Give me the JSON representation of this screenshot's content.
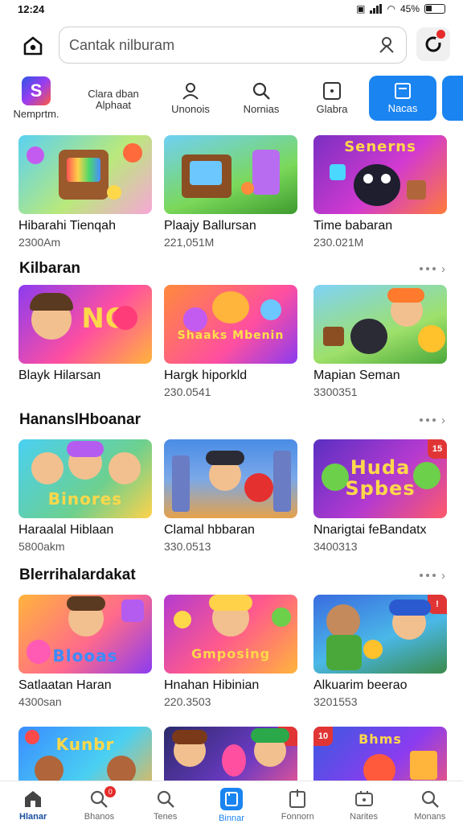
{
  "status": {
    "time": "12:24",
    "battery": "45%"
  },
  "search": {
    "placeholder": "Cantak nilburam"
  },
  "categories": [
    {
      "label": "Nemprtm.",
      "icon": "app-logo-icon"
    },
    {
      "label": "Clara dban Alphaat",
      "icon": "text-icon"
    },
    {
      "label": "Unonois",
      "icon": "person-icon"
    },
    {
      "label": "Nornias",
      "icon": "search-icon"
    },
    {
      "label": "Glabra",
      "icon": "square-icon"
    },
    {
      "label": "Nacas",
      "icon": "tablet-icon"
    }
  ],
  "sections": [
    {
      "title": "",
      "cards": [
        {
          "title": "Hibarahi Tienqah",
          "sub": "2300Am"
        },
        {
          "title": "Plaajy Ballursan",
          "sub": "221,051M"
        },
        {
          "title": "Time babaran",
          "sub": "230.021M",
          "banner": "Senerns"
        }
      ]
    },
    {
      "title": "Kilbaran",
      "cards": [
        {
          "title": "Blayk Hilarsan",
          "sub": "",
          "banner": "NO"
        },
        {
          "title": "Hargk hiporkld",
          "sub": "230.0541",
          "banner": "Shaaks Mbenin"
        },
        {
          "title": "Mapian Seman",
          "sub": "3300351"
        }
      ]
    },
    {
      "title": "HananslHboanar",
      "cards": [
        {
          "title": "Haraalal Hiblaan",
          "sub": "5800akm",
          "banner": "Binores"
        },
        {
          "title": "Clamal hbbaran",
          "sub": "330.0513"
        },
        {
          "title": "Nnarigtai feBandatx",
          "sub": "3400313",
          "banner": "Huda Spbes",
          "badge": "15"
        }
      ]
    },
    {
      "title": "Blerrihalardakat",
      "cards": [
        {
          "title": "Satlaatan Haran",
          "sub": "4300san",
          "banner": "Blooas"
        },
        {
          "title": "Hnahan Hibinian",
          "sub": "220.3503",
          "banner": "Gmposing"
        },
        {
          "title": "Alkuarim beerao",
          "sub": "3201553"
        }
      ]
    },
    {
      "title": "",
      "cards": [
        {
          "title": "",
          "sub": "",
          "banner": "Kunbr"
        },
        {
          "title": "",
          "sub": ""
        },
        {
          "title": "",
          "sub": "",
          "banner": "Bhms",
          "badge": "10"
        }
      ]
    }
  ],
  "bottom_nav": [
    {
      "label": "Hlanar",
      "icon": "home-icon"
    },
    {
      "label": "Bhanos",
      "icon": "search-badge-icon",
      "badge": "0"
    },
    {
      "label": "Tenes",
      "icon": "search-icon"
    },
    {
      "label": "Binnar",
      "icon": "tablet-icon"
    },
    {
      "label": "Fonnorn",
      "icon": "bookmark-icon"
    },
    {
      "label": "Narites",
      "icon": "gamepad-icon"
    },
    {
      "label": "Monans",
      "icon": "search-icon"
    }
  ],
  "colors": {
    "accent": "#1a84f0",
    "badge": "#e52b2b"
  }
}
